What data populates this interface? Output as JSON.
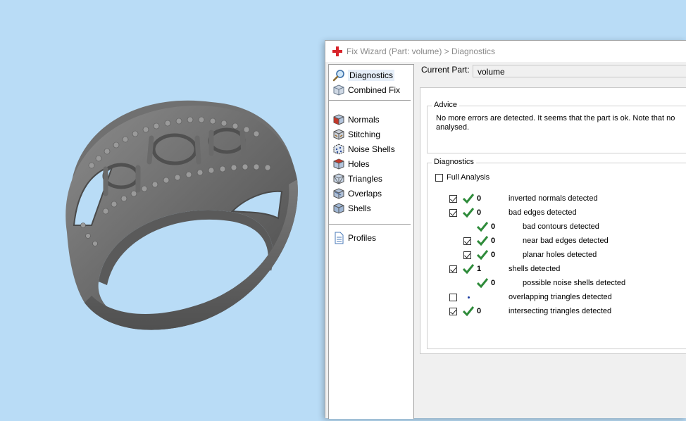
{
  "wizard": {
    "title": "Fix Wizard (Part: volume) > Diagnostics",
    "current_part_label": "Current Part:",
    "current_part_value": "volume"
  },
  "nav": {
    "items": [
      {
        "label": "Diagnostics",
        "icon": "magnifier-icon",
        "active": true
      },
      {
        "label": "Combined Fix",
        "icon": "cube-icon"
      },
      {
        "label": "Normals",
        "icon": "normals-cube-icon"
      },
      {
        "label": "Stitching",
        "icon": "stitching-cube-icon"
      },
      {
        "label": "Noise Shells",
        "icon": "noise-shells-icon"
      },
      {
        "label": "Holes",
        "icon": "holes-cube-icon"
      },
      {
        "label": "Triangles",
        "icon": "triangles-cube-icon"
      },
      {
        "label": "Overlaps",
        "icon": "overlaps-cube-icon"
      },
      {
        "label": "Shells",
        "icon": "shells-cube-icon"
      },
      {
        "label": "Profiles",
        "icon": "document-icon"
      }
    ]
  },
  "advice": {
    "title": "Advice",
    "text": "No more errors are detected. It seems that the part is ok. Note that no analysed."
  },
  "diagnostics": {
    "title": "Diagnostics",
    "full_analysis_label": "Full Analysis",
    "rows": [
      {
        "label": "inverted normals detected",
        "count": "0",
        "checked": true,
        "indent": 0,
        "status": "ok"
      },
      {
        "label": "bad edges detected",
        "count": "0",
        "checked": true,
        "indent": 0,
        "status": "ok"
      },
      {
        "label": "bad contours detected",
        "count": "0",
        "checked": null,
        "indent": 1,
        "status": "ok"
      },
      {
        "label": "near bad edges detected",
        "count": "0",
        "checked": true,
        "indent": 1,
        "status": "ok"
      },
      {
        "label": "planar holes detected",
        "count": "0",
        "checked": true,
        "indent": 1,
        "status": "ok"
      },
      {
        "label": "shells detected",
        "count": "1",
        "checked": true,
        "indent": 0,
        "status": "ok"
      },
      {
        "label": "possible noise shells detected",
        "count": "0",
        "checked": null,
        "indent": 1,
        "status": "ok"
      },
      {
        "label": "overlapping triangles detected",
        "count": "",
        "checked": false,
        "indent": 0,
        "status": "not-analysed"
      },
      {
        "label": "intersecting triangles detected",
        "count": "0",
        "checked": true,
        "indent": 0,
        "status": "ok"
      }
    ]
  },
  "colors": {
    "background": "#b9dcf6",
    "check_green": "#2e8b3a",
    "ring_metal": "#6e6e6e"
  }
}
